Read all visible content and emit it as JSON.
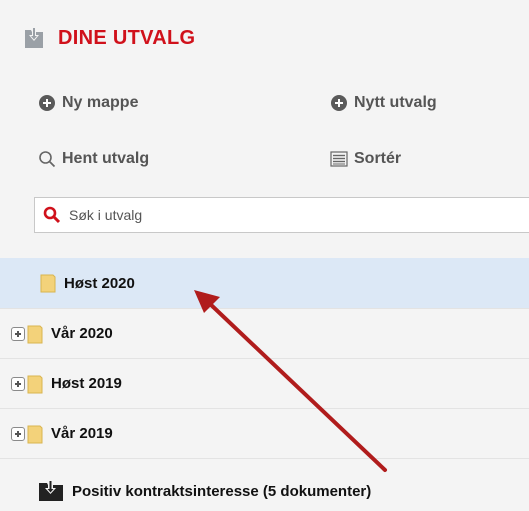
{
  "header": {
    "title": "DINE UTVALG",
    "icon": "folder-download-icon"
  },
  "actions": {
    "new_folder": "Ny mappe",
    "new_selection": "Nytt utvalg",
    "fetch_selection": "Hent utvalg",
    "sort": "Sortér"
  },
  "search": {
    "placeholder": "Søk i utvalg",
    "value": ""
  },
  "folders": [
    {
      "label": "Høst 2020",
      "selected": true,
      "expandable": false
    },
    {
      "label": "Vår 2020",
      "selected": false,
      "expandable": true
    },
    {
      "label": "Høst 2019",
      "selected": false,
      "expandable": true
    },
    {
      "label": "Vår 2019",
      "selected": false,
      "expandable": true
    }
  ],
  "saved_selection": {
    "label": "Positiv kontraktsinteresse (5 dokumenter)"
  },
  "colors": {
    "accent": "#d0111b",
    "selected_bg": "#dce8f6",
    "arrow": "#b01c1c",
    "folder": "#f3d27a"
  }
}
